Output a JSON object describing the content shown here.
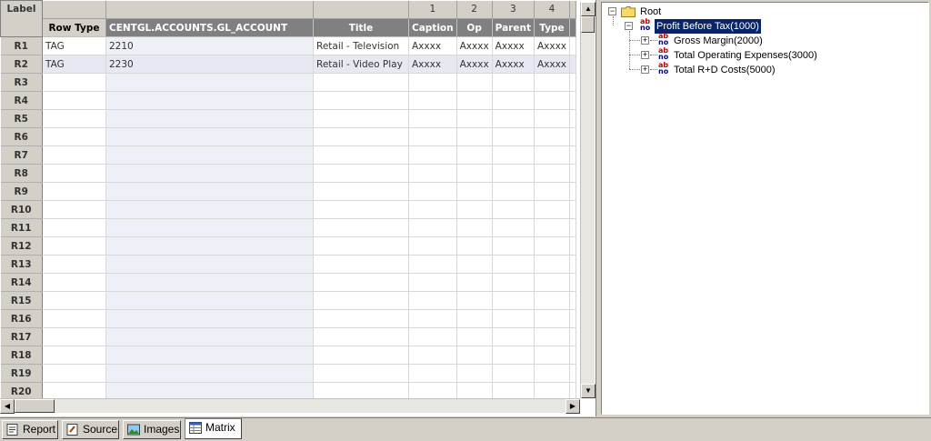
{
  "grid": {
    "corner_label": "Label",
    "column_numbers": [
      "",
      "",
      "",
      "1",
      "2",
      "3",
      "4"
    ],
    "headers": [
      "Row Type",
      "CENTGL.ACCOUNTS.GL_ACCOUNT",
      "Title",
      "Caption",
      "Op",
      "Parent",
      "Type"
    ],
    "rows": [
      {
        "label": "R1",
        "cells": [
          "TAG",
          "2210",
          "Retail - Television",
          "Axxxx",
          "Axxxx",
          "Axxxx",
          "Axxxx"
        ]
      },
      {
        "label": "R2",
        "cells": [
          "TAG",
          "2230",
          "Retail - Video Play",
          "Axxxx",
          "Axxxx",
          "Axxxx",
          "Axxxx"
        ]
      },
      {
        "label": "R3",
        "cells": [
          "",
          "",
          "",
          "",
          "",
          "",
          ""
        ]
      },
      {
        "label": "R4",
        "cells": [
          "",
          "",
          "",
          "",
          "",
          "",
          ""
        ]
      },
      {
        "label": "R5",
        "cells": [
          "",
          "",
          "",
          "",
          "",
          "",
          ""
        ]
      },
      {
        "label": "R6",
        "cells": [
          "",
          "",
          "",
          "",
          "",
          "",
          ""
        ]
      },
      {
        "label": "R7",
        "cells": [
          "",
          "",
          "",
          "",
          "",
          "",
          ""
        ]
      },
      {
        "label": "R8",
        "cells": [
          "",
          "",
          "",
          "",
          "",
          "",
          ""
        ]
      },
      {
        "label": "R9",
        "cells": [
          "",
          "",
          "",
          "",
          "",
          "",
          ""
        ]
      },
      {
        "label": "R10",
        "cells": [
          "",
          "",
          "",
          "",
          "",
          "",
          ""
        ]
      },
      {
        "label": "R11",
        "cells": [
          "",
          "",
          "",
          "",
          "",
          "",
          ""
        ]
      },
      {
        "label": "R12",
        "cells": [
          "",
          "",
          "",
          "",
          "",
          "",
          ""
        ]
      },
      {
        "label": "R13",
        "cells": [
          "",
          "",
          "",
          "",
          "",
          "",
          ""
        ]
      },
      {
        "label": "R14",
        "cells": [
          "",
          "",
          "",
          "",
          "",
          "",
          ""
        ]
      },
      {
        "label": "R15",
        "cells": [
          "",
          "",
          "",
          "",
          "",
          "",
          ""
        ]
      },
      {
        "label": "R16",
        "cells": [
          "",
          "",
          "",
          "",
          "",
          "",
          ""
        ]
      },
      {
        "label": "R17",
        "cells": [
          "",
          "",
          "",
          "",
          "",
          "",
          ""
        ]
      },
      {
        "label": "R18",
        "cells": [
          "",
          "",
          "",
          "",
          "",
          "",
          ""
        ]
      },
      {
        "label": "R19",
        "cells": [
          "",
          "",
          "",
          "",
          "",
          "",
          ""
        ]
      },
      {
        "label": "R20",
        "cells": [
          "",
          "",
          "",
          "",
          "",
          "",
          ""
        ]
      }
    ]
  },
  "tree": {
    "root": {
      "label": "Root",
      "icon": "folder-icon"
    },
    "selected": {
      "label": "Profit Before Tax(1000)",
      "icon": "ab-field-icon"
    },
    "children": [
      {
        "label": "Gross Margin(2000)",
        "icon": "ab-field-icon"
      },
      {
        "label": "Total Operating Expenses(3000)",
        "icon": "ab-field-icon"
      },
      {
        "label": "Total R+D Costs(5000)",
        "icon": "ab-field-icon"
      }
    ],
    "ab_top": "ab",
    "ab_bottom": "no"
  },
  "tabs": [
    {
      "label": "Report",
      "icon": "report-icon"
    },
    {
      "label": "Source",
      "icon": "source-icon"
    },
    {
      "label": "Images",
      "icon": "images-icon"
    },
    {
      "label": "Matrix",
      "icon": "matrix-icon",
      "active": true
    }
  ],
  "colors": {
    "header_bg": "#808080",
    "selection": "#0a246a",
    "chrome": "#d4d0c8"
  }
}
